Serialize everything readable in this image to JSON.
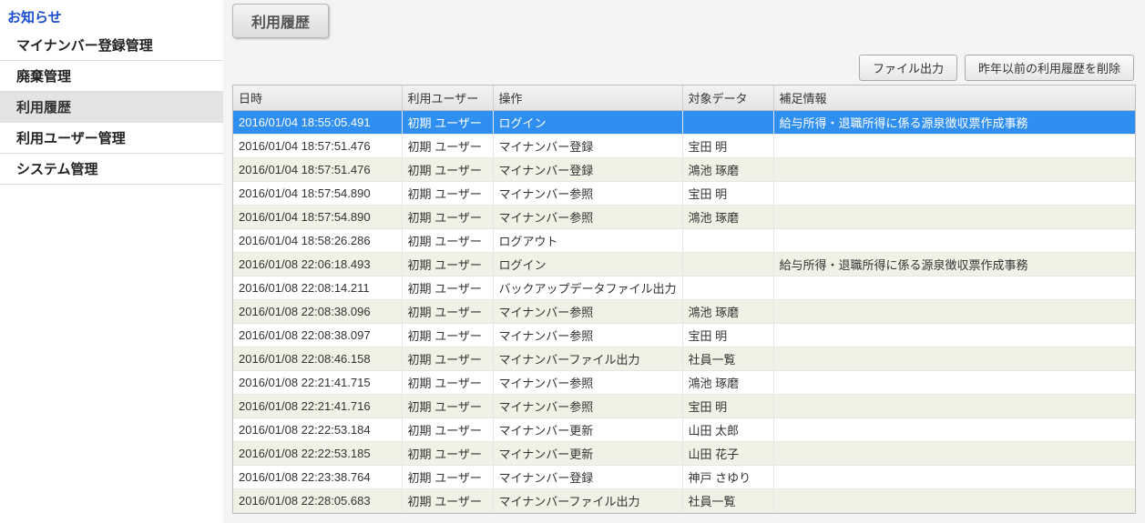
{
  "sidebar": {
    "title": "お知らせ",
    "items": [
      {
        "label": "マイナンバー登録管理",
        "selected": false
      },
      {
        "label": "廃棄管理",
        "selected": false
      },
      {
        "label": "利用履歴",
        "selected": true
      },
      {
        "label": "利用ユーザー管理",
        "selected": false
      },
      {
        "label": "システム管理",
        "selected": false
      }
    ]
  },
  "page": {
    "heading": "利用履歴"
  },
  "toolbar": {
    "export_label": "ファイル出力",
    "delete_label": "昨年以前の利用履歴を削除"
  },
  "table": {
    "headers": {
      "datetime": "日時",
      "user": "利用ユーザー",
      "operation": "操作",
      "target": "対象データ",
      "remark": "補足情報"
    },
    "rows": [
      {
        "datetime": "2016/01/04 18:55:05.491",
        "user": "初期 ユーザー",
        "operation": "ログイン",
        "target": "",
        "remark": "給与所得・退職所得に係る源泉徴収票作成事務",
        "selected": true
      },
      {
        "datetime": "2016/01/04 18:57:51.476",
        "user": "初期 ユーザー",
        "operation": "マイナンバー登録",
        "target": "宝田 明",
        "remark": ""
      },
      {
        "datetime": "2016/01/04 18:57:51.476",
        "user": "初期 ユーザー",
        "operation": "マイナンバー登録",
        "target": "鴻池 琢磨",
        "remark": ""
      },
      {
        "datetime": "2016/01/04 18:57:54.890",
        "user": "初期 ユーザー",
        "operation": "マイナンバー参照",
        "target": "宝田 明",
        "remark": ""
      },
      {
        "datetime": "2016/01/04 18:57:54.890",
        "user": "初期 ユーザー",
        "operation": "マイナンバー参照",
        "target": "鴻池 琢磨",
        "remark": ""
      },
      {
        "datetime": "2016/01/04 18:58:26.286",
        "user": "初期 ユーザー",
        "operation": "ログアウト",
        "target": "",
        "remark": ""
      },
      {
        "datetime": "2016/01/08 22:06:18.493",
        "user": "初期 ユーザー",
        "operation": "ログイン",
        "target": "",
        "remark": "給与所得・退職所得に係る源泉徴収票作成事務"
      },
      {
        "datetime": "2016/01/08 22:08:14.211",
        "user": "初期 ユーザー",
        "operation": "バックアップデータファイル出力",
        "target": "",
        "remark": ""
      },
      {
        "datetime": "2016/01/08 22:08:38.096",
        "user": "初期 ユーザー",
        "operation": "マイナンバー参照",
        "target": "鴻池 琢磨",
        "remark": ""
      },
      {
        "datetime": "2016/01/08 22:08:38.097",
        "user": "初期 ユーザー",
        "operation": "マイナンバー参照",
        "target": "宝田 明",
        "remark": ""
      },
      {
        "datetime": "2016/01/08 22:08:46.158",
        "user": "初期 ユーザー",
        "operation": "マイナンバーファイル出力",
        "target": "社員一覧",
        "remark": ""
      },
      {
        "datetime": "2016/01/08 22:21:41.715",
        "user": "初期 ユーザー",
        "operation": "マイナンバー参照",
        "target": "鴻池 琢磨",
        "remark": ""
      },
      {
        "datetime": "2016/01/08 22:21:41.716",
        "user": "初期 ユーザー",
        "operation": "マイナンバー参照",
        "target": "宝田 明",
        "remark": ""
      },
      {
        "datetime": "2016/01/08 22:22:53.184",
        "user": "初期 ユーザー",
        "operation": "マイナンバー更新",
        "target": "山田 太郎",
        "remark": ""
      },
      {
        "datetime": "2016/01/08 22:22:53.185",
        "user": "初期 ユーザー",
        "operation": "マイナンバー更新",
        "target": "山田 花子",
        "remark": ""
      },
      {
        "datetime": "2016/01/08 22:23:38.764",
        "user": "初期 ユーザー",
        "operation": "マイナンバー登録",
        "target": "神戸 さゆり",
        "remark": ""
      },
      {
        "datetime": "2016/01/08 22:28:05.683",
        "user": "初期 ユーザー",
        "operation": "マイナンバーファイル出力",
        "target": "社員一覧",
        "remark": ""
      }
    ]
  }
}
